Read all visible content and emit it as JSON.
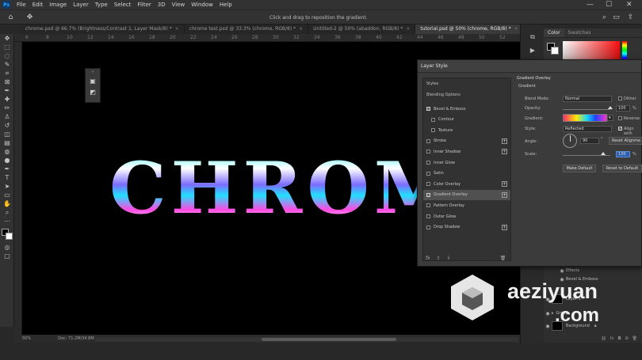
{
  "app": {
    "logo": "Ps"
  },
  "menu": [
    "File",
    "Edit",
    "Image",
    "Layer",
    "Type",
    "Select",
    "Filter",
    "3D",
    "View",
    "Window",
    "Help"
  ],
  "window_controls": [
    "—",
    "☐",
    "✕"
  ],
  "options_bar": {
    "hint": "Click and drag to reposition the gradient."
  },
  "tabs": [
    {
      "label": "chrome.psd @ 66.7% (Brightness/Contrast 1, Layer Mask/8) *"
    },
    {
      "label": "chrome test.psd @ 33.3% (chrome, RGB/8) *"
    },
    {
      "label": "Untitled-2 @ 50% (abaddon, RGB/8) *"
    },
    {
      "label": "tutorial.psd @ 50% (chrome, RGB/8) *"
    }
  ],
  "ruler": [
    "6",
    "8",
    "10",
    "12",
    "14",
    "16",
    "18",
    "20",
    "22",
    "24",
    "26",
    "28",
    "30",
    "32",
    "34",
    "36",
    "38",
    "40",
    "42",
    "44",
    "46",
    "48",
    "50",
    "52"
  ],
  "canvas": {
    "text": "CHROM"
  },
  "status": {
    "zoom": "50%",
    "doc": "Doc: 71.2M/34.8M"
  },
  "color_panel": {
    "tabs": [
      "Color",
      "Swatches"
    ]
  },
  "layers": {
    "rows": [
      {
        "label": "Effects"
      },
      {
        "label": "Bevel & Emboss"
      },
      {
        "label": "Layer 1"
      },
      {
        "label": "Group"
      },
      {
        "label": "Background"
      }
    ]
  },
  "watermark": {
    "main": "aeziyuan",
    "sub": ".com"
  },
  "dialog": {
    "title": "Layer Style",
    "styles_header": "Styles",
    "blending_options": "Blending Options",
    "items": [
      {
        "label": "Bevel & Emboss",
        "checked": true,
        "plus": false,
        "indent": false
      },
      {
        "label": "Contour",
        "checked": false,
        "plus": false,
        "indent": true
      },
      {
        "label": "Texture",
        "checked": false,
        "plus": false,
        "indent": true
      },
      {
        "label": "Stroke",
        "checked": false,
        "plus": true,
        "indent": false
      },
      {
        "label": "Inner Shadow",
        "checked": false,
        "plus": true,
        "indent": false
      },
      {
        "label": "Inner Glow",
        "checked": false,
        "plus": false,
        "indent": false
      },
      {
        "label": "Satin",
        "checked": false,
        "plus": false,
        "indent": false
      },
      {
        "label": "Color Overlay",
        "checked": false,
        "plus": true,
        "indent": false
      },
      {
        "label": "Gradient Overlay",
        "checked": true,
        "plus": true,
        "indent": false
      },
      {
        "label": "Pattern Overlay",
        "checked": false,
        "plus": false,
        "indent": false
      },
      {
        "label": "Outer Glow",
        "checked": false,
        "plus": false,
        "indent": false
      },
      {
        "label": "Drop Shadow",
        "checked": false,
        "plus": true,
        "indent": false
      }
    ],
    "footer": "fx",
    "right": {
      "section": "Gradient Overlay",
      "subsection": "Gradient",
      "blend_mode_label": "Blend Mode:",
      "blend_mode_value": "Normal",
      "dither_label": "Dither",
      "opacity_label": "Opacity:",
      "opacity_value": "100",
      "opacity_unit": "%",
      "gradient_label": "Gradient:",
      "reverse_label": "Reverse",
      "style_label": "Style:",
      "style_value": "Reflected",
      "align_label": "Align with",
      "angle_label": "Angle:",
      "angle_value": "90",
      "reset_alignment": "Reset Alignme",
      "scale_label": "Scale:",
      "scale_value": "130",
      "scale_unit": "%",
      "make_default": "Make Default",
      "reset_default": "Reset to Default"
    }
  }
}
